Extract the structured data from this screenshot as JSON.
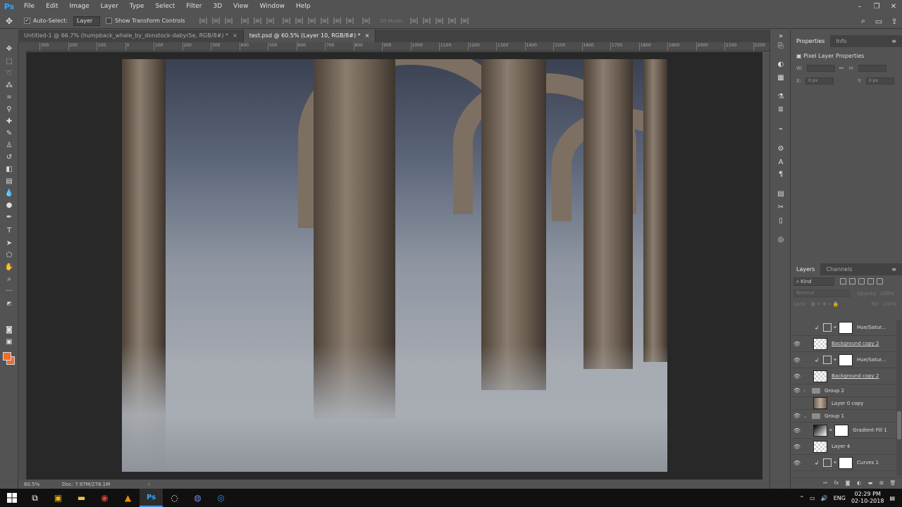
{
  "app": {
    "logo": "Ps",
    "menu": [
      "File",
      "Edit",
      "Image",
      "Layer",
      "Type",
      "Select",
      "Filter",
      "3D",
      "View",
      "Window",
      "Help"
    ],
    "window_controls": [
      "–",
      "❐",
      "✕"
    ]
  },
  "options_bar": {
    "auto_select_label": "Auto-Select:",
    "auto_select_value": "Layer",
    "show_transform_label": "Show Transform Controls",
    "mode_3d_label": "3D Mode:"
  },
  "tabs": [
    {
      "label": "Untitled-1 @ 66.7% (humpback_whale_by_donstock-dabyr5e, RGB/8#) *",
      "close": "×"
    },
    {
      "label": "test.psd @ 60.5% (Layer 10, RGB/8#) *",
      "close": "×"
    }
  ],
  "ruler": {
    "top_labels": [
      "300",
      "200",
      "100",
      "0",
      "100",
      "200",
      "300",
      "400",
      "500",
      "600",
      "700",
      "800",
      "900",
      "1000",
      "1100",
      "1200",
      "1300",
      "1400",
      "1500",
      "1600",
      "1700",
      "1800",
      "1900",
      "2000",
      "2100",
      "2200"
    ]
  },
  "status": {
    "zoom": "60.5%",
    "doc": "Doc: 7.97M/278.1M",
    "arrow": "›"
  },
  "properties_panel": {
    "tabs": [
      "Properties",
      "Info"
    ],
    "title": "Pixel Layer Properties",
    "w_label": "W:",
    "h_label": "H:",
    "x_label": "X:",
    "x_value": "0 px",
    "y_label": "Y:",
    "y_value": "0 px"
  },
  "layers_panel": {
    "tabs": [
      "Layers",
      "Channels"
    ],
    "kind": "Kind",
    "blend_mode": "Normal",
    "opacity_label": "Opacity:",
    "opacity_value": "100%",
    "lock_label": "Lock:",
    "fill_label": "Fill:",
    "fill_value": "100%",
    "layers": [
      {
        "name": "Hue/Satur...",
        "visible": false
      },
      {
        "name": "Background copy 2",
        "visible": true
      },
      {
        "name": "Hue/Satur...",
        "visible": true
      },
      {
        "name": "Background copy 2",
        "visible": true
      },
      {
        "name": "Group 2",
        "visible": true
      },
      {
        "name": "Layer 0 copy",
        "visible": false
      },
      {
        "name": "Group 1",
        "visible": true
      },
      {
        "name": "Gradient Fill 1",
        "visible": true
      },
      {
        "name": "Layer 4",
        "visible": true
      },
      {
        "name": "Curves 1",
        "visible": true
      }
    ]
  },
  "taskbar": {
    "language": "ENG",
    "time": "02:29 PM",
    "date": "02-10-2018"
  },
  "colors": {
    "foreground": "#ef6c2a",
    "ui_panel": "#535353",
    "accent": "#31a8ff"
  }
}
